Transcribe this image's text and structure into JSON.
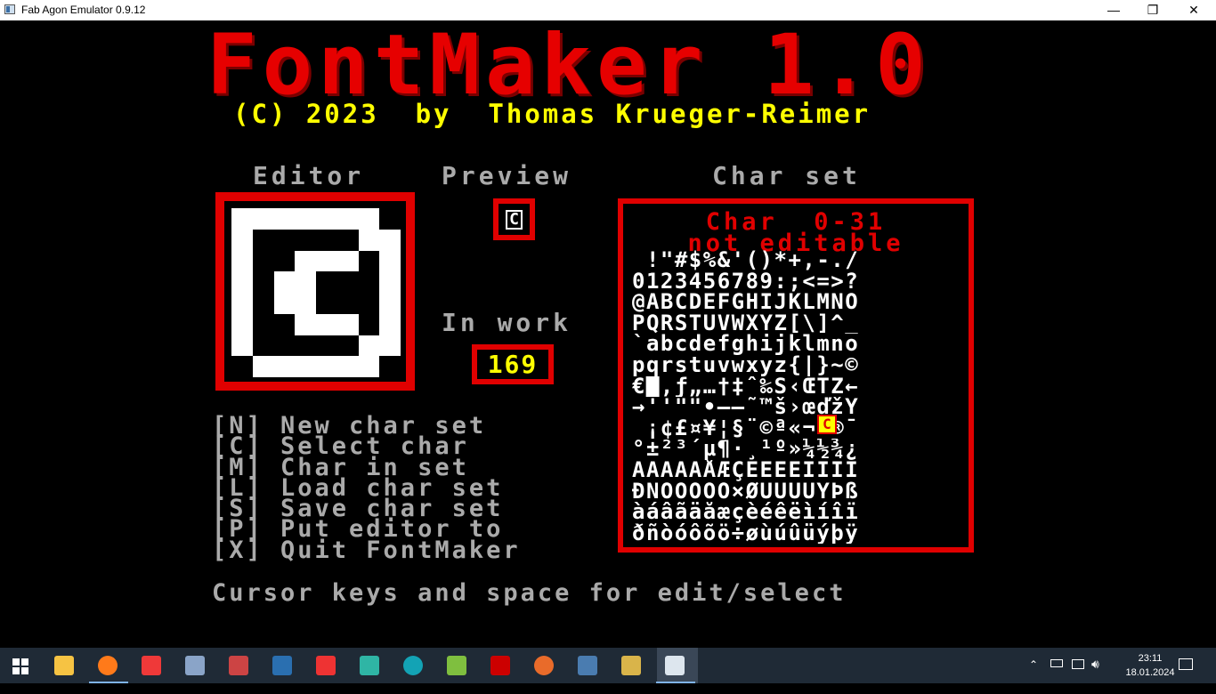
{
  "window": {
    "title": "Fab Agon Emulator 0.9.12",
    "minimize": "—",
    "maximize": "❐",
    "close": "✕"
  },
  "app": {
    "title": "FontMaker 1.0",
    "credit": "(C) 2023  by  Thomas Krueger-Reimer"
  },
  "editor": {
    "label": "Editor",
    "pixels": [
      "11111110",
      "10000011",
      "10011101",
      "10110001",
      "10110001",
      "10011101",
      "10000011",
      "01111110"
    ]
  },
  "preview": {
    "label": "Preview",
    "char": "C"
  },
  "in_work": {
    "label": "In work",
    "value": "169"
  },
  "menu": [
    "[N] New char set",
    "[C] Select char",
    "[M] Char in set",
    "[L] Load char set",
    "[S] Save char set",
    "[P] Put editor to",
    "[X] Quit FontMaker"
  ],
  "hint": "Cursor keys and space for edit/select",
  "charset": {
    "label": "Char set",
    "header_line1": "Char  0-31",
    "header_line2": "not editable",
    "rows": [
      " !\"#$%&'()*+,-./",
      "0123456789:;<=>?",
      "@ABCDEFGHIJKLMNO",
      "PQRSTUVWXYZ[\\]^_",
      "`abcdefghijklmno",
      "pqrstuvwxyz{|}~©",
      "€█‚ƒ„…†‡ˆ‰Š‹ŒŤŽ←",
      "→''\"\"•–—˜™š›œďžŸ",
      " ¡¢£¤¥¦§¨©ª«¬-®¯",
      "°±²³´µ¶·¸¹º»¼½¾¿",
      "ÀÁÂÃÄÅÆÇÈÉÊËÌÍÎÏ",
      "ÐÑÒÓÔÕÖ×ØÙÚÛÜÝÞß",
      "àáâãäåæçèéêëìíîï",
      "ðñòóôõö÷øùúûüýþÿ"
    ],
    "selected_char": "C"
  },
  "taskbar": {
    "time": "23:11",
    "date": "18.01.2024",
    "icons": [
      "file-explorer-icon",
      "firefox-icon",
      "vivaldi-icon",
      "control-panel-icon",
      "wand-icon",
      "terminal-icon",
      "filezilla-red-icon",
      "pycharm-icon",
      "arduino-icon",
      "image-viewer-icon",
      "filezilla-icon",
      "bitwarden-icon",
      "notepad-icon",
      "agon-icon",
      "emulator-icon"
    ]
  },
  "colors": {
    "accent_red": "#e00000",
    "title_yellow": "#ffff00",
    "text_grey": "#aaaaaa",
    "taskbar_bg": "#1f2a36"
  }
}
